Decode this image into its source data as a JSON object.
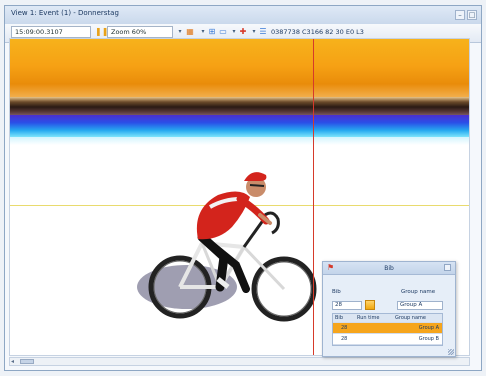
{
  "window": {
    "title": "View 1: Event (1) - Donnerstag"
  },
  "toolbar": {
    "time_value": "15:09:00.3107",
    "zoom_label": "Zoom 60%",
    "status_text": "0387738 C3166 82 30 E0 L3"
  },
  "bib_panel": {
    "title": "Bib",
    "bib_label": "Bib",
    "group_label": "Group name",
    "bib_value": "28",
    "group_value": "Group A",
    "table": {
      "headers": [
        "Bib",
        "Run time",
        "Group name"
      ],
      "rows": [
        {
          "bib": "28",
          "run_time": "",
          "group": "Group A"
        },
        {
          "bib": "28",
          "run_time": "",
          "group": "Group B"
        }
      ]
    }
  },
  "colors": {
    "accent_orange": "#f6a51c",
    "finish_line": "#d63a2a",
    "chrome_blue": "#cad9ec"
  },
  "icons": [
    "flag-icon",
    "pause-icon",
    "camera-icon",
    "grid-icon",
    "monitor-icon",
    "cross-icon",
    "list-icon",
    "minimize-icon",
    "maximize-icon",
    "close-icon"
  ]
}
